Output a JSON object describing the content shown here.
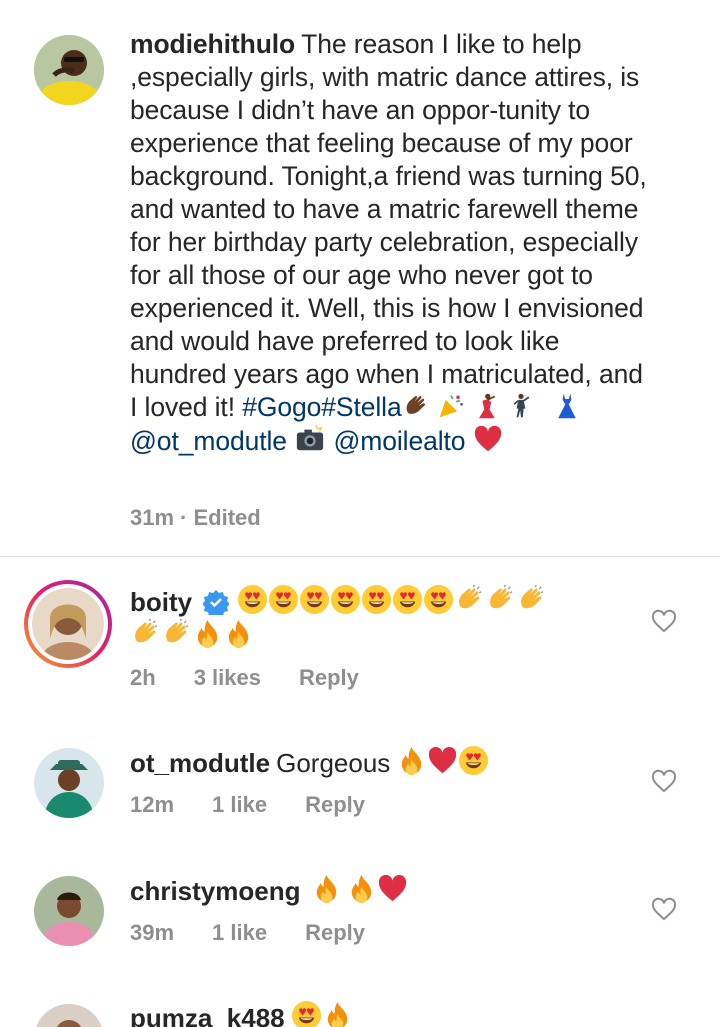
{
  "post": {
    "username": "modiehithulo",
    "caption": "The reason I like to help ,especially girls, with matric dance attires, is because I didn’t have an oppor-tunity to experience that feeling because of my poor background. Tonight,a friend was turning 50, and wanted to have a matric farewell theme for her birthday party celebration, especially for all those of our age who never got to experienced it. Well, this  is how I envisioned and would have preferred to look like hundred years ago when I matriculated, and I loved it!",
    "hashtags": "#Gogo#Stella",
    "mention1": "@ot_modutle",
    "mention2": "@moilealto",
    "time": "31m",
    "edited": "· Edited",
    "emojis": [
      "clapping-hands",
      "party-popper",
      "woman-dancing",
      "man-dancing",
      "dress",
      "camera-flash",
      "red-heart"
    ]
  },
  "comments": [
    {
      "username": "boity",
      "verified": true,
      "emojis": [
        "heart-eyes x7",
        "clapping-hands x5",
        "fire x2"
      ],
      "time": "2h",
      "likes": "3 likes",
      "reply": "Reply"
    },
    {
      "username": "ot_modutle",
      "text": "Gorgeous",
      "emojis": [
        "fire",
        "red-heart",
        "heart-eyes"
      ],
      "time": "12m",
      "likes": "1 like",
      "reply": "Reply"
    },
    {
      "username": "christymoeng",
      "emojis": [
        "fire",
        "fire",
        "red-heart"
      ],
      "time": "39m",
      "likes": "1 like",
      "reply": "Reply"
    },
    {
      "username": "pumza_k488",
      "emojis": [
        "heart-eyes",
        "fire"
      ]
    }
  ],
  "colors": {
    "text": "#262626",
    "secondary": "#8e8e8e",
    "link": "#00376b",
    "divider": "#dbdbdb",
    "verified": "#3897f0"
  }
}
